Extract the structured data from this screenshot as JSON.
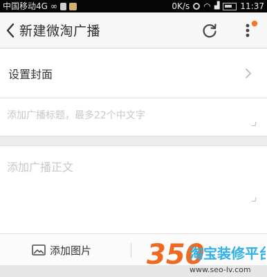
{
  "status_bar": {
    "carrier": "中国移动4G",
    "net_speed": "0K/s",
    "time": "11:37",
    "icons": [
      "infinity-icon",
      "phone-icon",
      "yen-icon",
      "alarm-icon",
      "wifi-icon",
      "signal-icon",
      "battery-icon"
    ]
  },
  "header": {
    "title": "新建微淘广播",
    "back_icon": "chevron-left-icon",
    "refresh_icon": "refresh-icon",
    "more_icon": "more-vertical-icon",
    "notification_dot_color": "#f0762a"
  },
  "form": {
    "cover_label": "设置封面",
    "title_placeholder": "添加广播标题，最多22个中文字",
    "title_value": "",
    "body_placeholder": "添加广播正文",
    "body_value": ""
  },
  "bottom_bar": {
    "add_image_label": "添加图片",
    "add_image_icon": "image-icon"
  },
  "watermark": {
    "number": "350",
    "brand": "淘宝装修平台",
    "url": "www.seo-lv.com"
  },
  "colors": {
    "status_bar_bg": "#050505",
    "header_bg": "#f7f7f7",
    "accent_orange": "#f0762a",
    "watermark_orange": "#ef6a21",
    "watermark_blue": "#2fb0e6"
  }
}
